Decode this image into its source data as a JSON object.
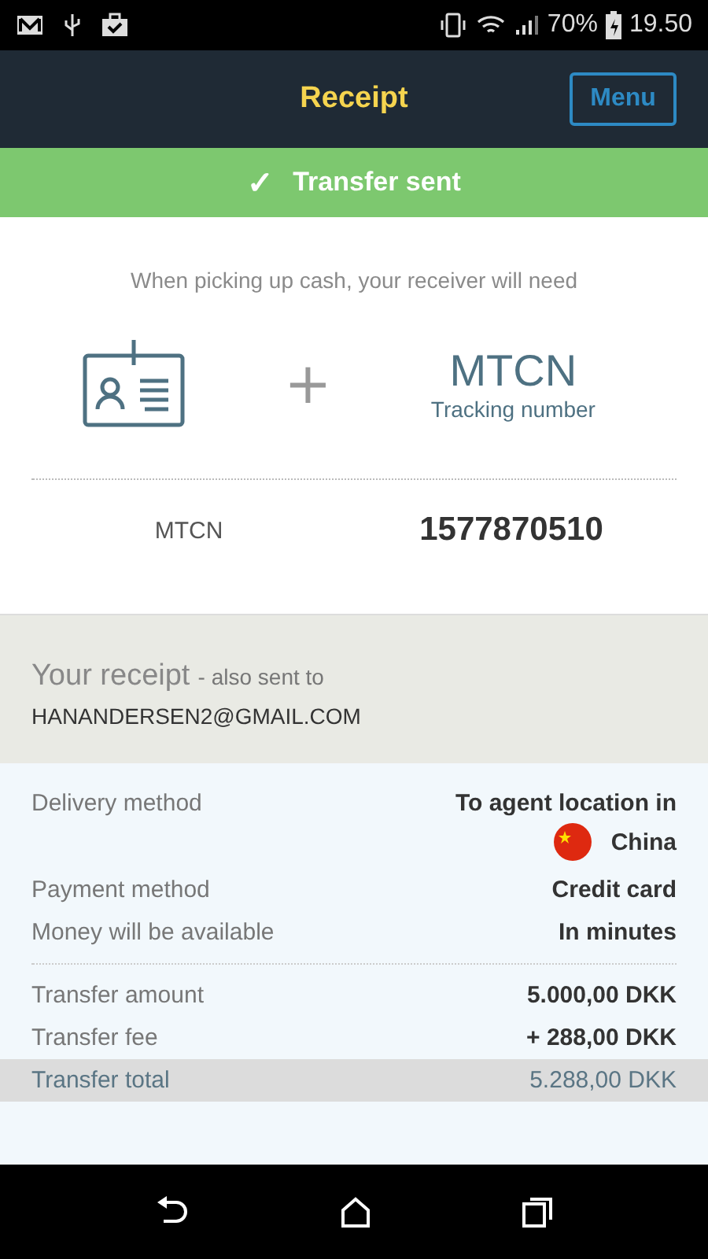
{
  "status_bar": {
    "battery": "70%",
    "time": "19.50"
  },
  "header": {
    "title": "Receipt",
    "menu_button": "Menu"
  },
  "banner": {
    "check": "✓",
    "text": "Transfer sent"
  },
  "pickup": {
    "intro": "When picking up cash, your receiver will need",
    "plus": "+",
    "code_title": "MTCN",
    "code_subtitle": "Tracking number",
    "mtcn_label": "MTCN",
    "mtcn_value": "1577870510"
  },
  "receipt": {
    "title": "Your receipt",
    "note": "- also sent to",
    "email": "HANANDERSEN2@GMAIL.COM"
  },
  "detail_groups": [
    [
      {
        "label": "Delivery method",
        "value": "To agent location in",
        "country": "China",
        "kind": "normal"
      },
      {
        "label": "Payment method",
        "value": "Credit card",
        "kind": "normal"
      },
      {
        "label": "Money will be available",
        "value": "In minutes",
        "kind": "normal"
      }
    ],
    [
      {
        "label": "Transfer amount",
        "value": "5.000,00 DKK",
        "kind": "normal"
      },
      {
        "label": "Transfer fee",
        "value": "+ 288,00 DKK",
        "kind": "normal"
      },
      {
        "label": "Transfer total",
        "value": "5.288,00 DKK",
        "kind": "total"
      }
    ]
  ]
}
